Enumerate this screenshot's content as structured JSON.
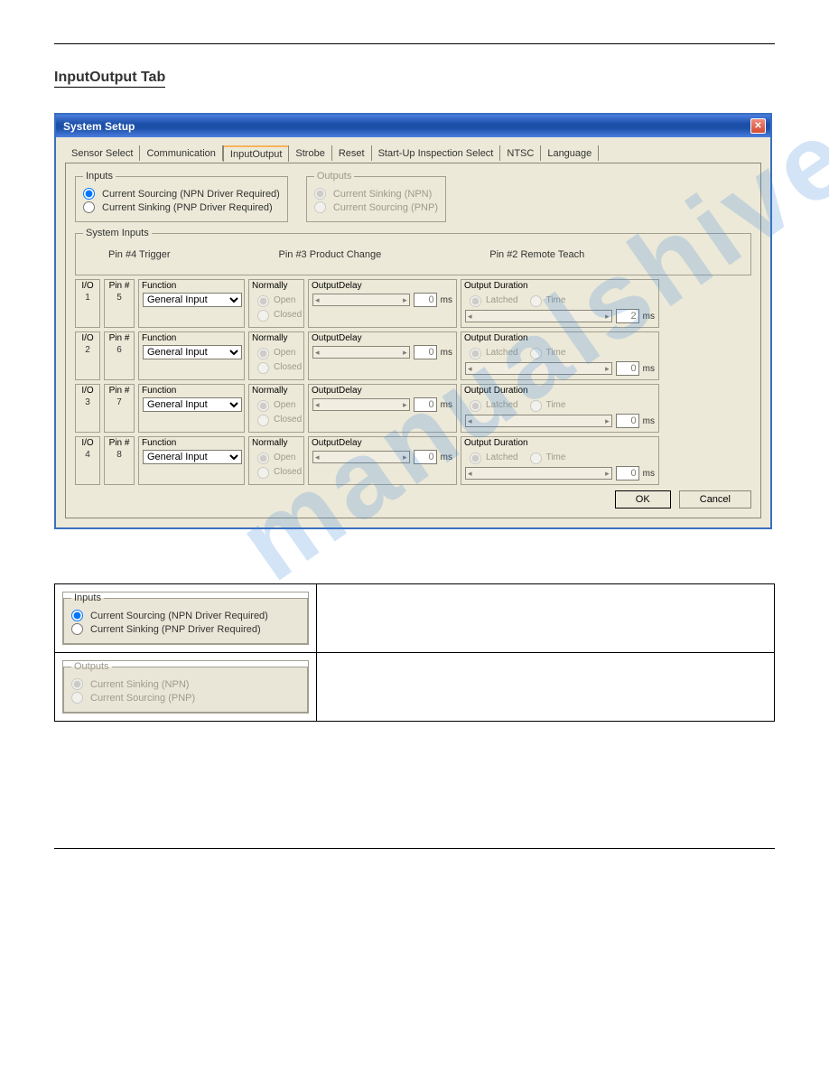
{
  "section_title": "InputOutput Tab",
  "window": {
    "title": "System  Setup",
    "tabs": [
      {
        "label": "Sensor Select"
      },
      {
        "label": "Communication"
      },
      {
        "label": "InputOutput",
        "active": true
      },
      {
        "label": "Strobe"
      },
      {
        "label": "Reset"
      },
      {
        "label": "Start-Up Inspection Select"
      },
      {
        "label": "NTSC"
      },
      {
        "label": "Language"
      }
    ],
    "inputs_group": {
      "legend": "Inputs",
      "opts": [
        {
          "label": "Current Sourcing  (NPN Driver Required)",
          "selected": true
        },
        {
          "label": "Current Sinking    (PNP Driver Required)",
          "selected": false
        }
      ]
    },
    "outputs_group": {
      "legend": "Outputs",
      "opts": [
        {
          "label": "Current Sinking    (NPN)",
          "selected": true
        },
        {
          "label": "Current Sourcing  (PNP)",
          "selected": false
        }
      ]
    },
    "system_inputs_legend": "System Inputs",
    "system_inputs_labels": [
      "Pin #4   Trigger",
      "Pin #3   Product Change",
      "Pin #2   Remote Teach"
    ],
    "col_headers": {
      "io": "I/O",
      "pin": "Pin #",
      "func": "Function",
      "norm": "Normally",
      "delay": "OutputDelay",
      "dur": "Output Duration"
    },
    "norm_opts": {
      "open": "Open",
      "closed": "Closed"
    },
    "dur_opts": {
      "latched": "Latched",
      "time": "Time"
    },
    "rows": [
      {
        "io": "1",
        "pin": "5",
        "func": "General Input",
        "delay": "0",
        "dur": "2"
      },
      {
        "io": "2",
        "pin": "6",
        "func": "General Input",
        "delay": "0",
        "dur": "0"
      },
      {
        "io": "3",
        "pin": "7",
        "func": "General Input",
        "delay": "0",
        "dur": "0"
      },
      {
        "io": "4",
        "pin": "8",
        "func": "General Input",
        "delay": "0",
        "dur": "0"
      }
    ],
    "ms_label": "ms",
    "buttons": {
      "ok": "OK",
      "cancel": "Cancel"
    }
  },
  "detail_inputs": {
    "legend": "Inputs",
    "opts": [
      {
        "label": "Current Sourcing  (NPN Driver Required)",
        "selected": true
      },
      {
        "label": "Current Sinking    (PNP Driver Required)",
        "selected": false
      }
    ]
  },
  "detail_outputs": {
    "legend": "Outputs",
    "opts": [
      {
        "label": "Current Sinking    (NPN)",
        "selected": true
      },
      {
        "label": "Current Sourcing  (PNP)",
        "selected": false
      }
    ]
  },
  "watermark": "manualshive.com"
}
